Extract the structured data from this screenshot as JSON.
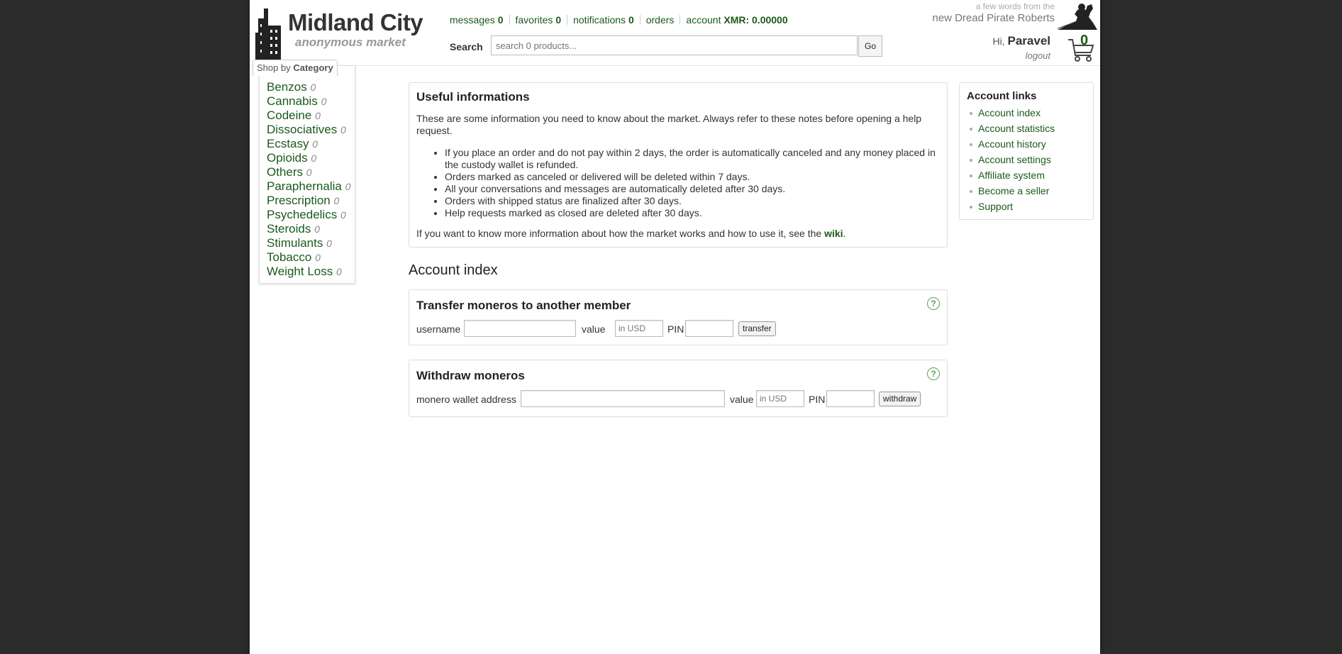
{
  "brand": {
    "name": "Midland City",
    "tagline": "anonymous market"
  },
  "topnav": {
    "messages_label": "messages",
    "messages_count": "0",
    "favorites_label": "favorites",
    "favorites_count": "0",
    "notifications_label": "notifications",
    "notifications_count": "0",
    "orders_label": "orders",
    "account_label": "account",
    "account_balance": "XMR: 0.00000"
  },
  "search": {
    "label": "Search",
    "placeholder": "search 0 products...",
    "button": "Go"
  },
  "dpr": {
    "line1": "a few words from the",
    "line2": "new Dread Pirate Roberts"
  },
  "user": {
    "greeting": "Hi,",
    "name": "Paravel",
    "logout": "logout",
    "cart_count": "0"
  },
  "categories": {
    "tab_prefix": "Shop by",
    "tab_bold": "Category",
    "items": [
      {
        "name": "Benzos",
        "count": "0"
      },
      {
        "name": "Cannabis",
        "count": "0"
      },
      {
        "name": "Codeine",
        "count": "0"
      },
      {
        "name": "Dissociatives",
        "count": "0"
      },
      {
        "name": "Ecstasy",
        "count": "0"
      },
      {
        "name": "Opioids",
        "count": "0"
      },
      {
        "name": "Others",
        "count": "0"
      },
      {
        "name": "Paraphernalia",
        "count": "0"
      },
      {
        "name": "Prescription",
        "count": "0"
      },
      {
        "name": "Psychedelics",
        "count": "0"
      },
      {
        "name": "Steroids",
        "count": "0"
      },
      {
        "name": "Stimulants",
        "count": "0"
      },
      {
        "name": "Tobacco",
        "count": "0"
      },
      {
        "name": "Weight Loss",
        "count": "0"
      }
    ]
  },
  "useful": {
    "title": "Useful informations",
    "intro": "These are some information you need to know about the market. Always refer to these notes before opening a help request.",
    "bullets": [
      "If you place an order and do not pay within 2 days, the order is automatically canceled and any money placed in the custody wallet is refunded.",
      "Orders marked as canceled or delivered will be deleted within 7 days.",
      "All your conversations and messages are automatically deleted after 30 days.",
      "Orders with shipped status are finalized after 30 days.",
      "Help requests marked as closed are deleted after 30 days."
    ],
    "footer_text": "If you want to know more information about how the market works and how to use it, see the",
    "footer_link": "wiki",
    "footer_end": "."
  },
  "account_index": {
    "title": "Account index"
  },
  "transfer": {
    "title": "Transfer moneros to another member",
    "help": "?",
    "username_label": "username",
    "value_label": "value",
    "value_placeholder": "in USD",
    "pin_label": "PIN",
    "button": "transfer"
  },
  "withdraw": {
    "title": "Withdraw moneros",
    "help": "?",
    "address_label": "monero wallet address",
    "value_label": "value",
    "value_placeholder": "in USD",
    "pin_label": "PIN",
    "button": "withdraw"
  },
  "account_links": {
    "title": "Account links",
    "items": [
      "Account index",
      "Account statistics",
      "Account history",
      "Account settings",
      "Affiliate system",
      "Become a seller",
      "Support"
    ]
  },
  "colors": {
    "link": "#1a5a1a",
    "background": "#2b2b2b",
    "accent_icon": "#5aa05a"
  }
}
